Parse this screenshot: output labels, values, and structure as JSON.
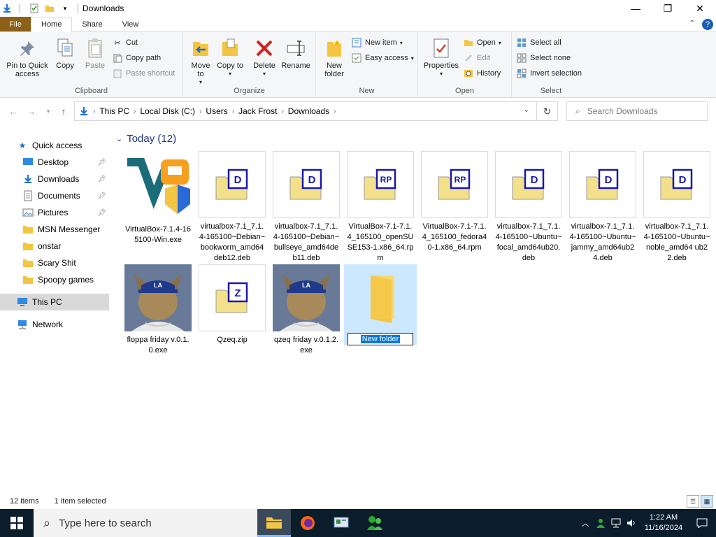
{
  "window": {
    "title": "Downloads",
    "controls": {
      "minimize": "—",
      "maximize": "❐",
      "close": "✕"
    }
  },
  "ribbon_tabs": [
    "File",
    "Home",
    "Share",
    "View"
  ],
  "ribbon": {
    "clipboard": {
      "label": "Clipboard",
      "pin": "Pin to Quick access",
      "copy": "Copy",
      "paste": "Paste",
      "cut": "Cut",
      "copy_path": "Copy path",
      "paste_shortcut": "Paste shortcut"
    },
    "organize": {
      "label": "Organize",
      "move_to": "Move to",
      "copy_to": "Copy to",
      "delete": "Delete",
      "rename": "Rename"
    },
    "new": {
      "label": "New",
      "new_folder": "New folder",
      "new_item": "New item",
      "easy_access": "Easy access"
    },
    "open": {
      "label": "Open",
      "properties": "Properties",
      "open": "Open",
      "edit": "Edit",
      "history": "History"
    },
    "select": {
      "label": "Select",
      "select_all": "Select all",
      "select_none": "Select none",
      "invert": "Invert selection"
    }
  },
  "address": {
    "crumbs": [
      "This PC",
      "Local Disk (C:)",
      "Users",
      "Jack Frost",
      "Downloads"
    ],
    "search_placeholder": "Search Downloads"
  },
  "nav": {
    "quick_access": "Quick access",
    "items": [
      {
        "label": "Desktop",
        "pinned": true
      },
      {
        "label": "Downloads",
        "pinned": true
      },
      {
        "label": "Documents",
        "pinned": true
      },
      {
        "label": "Pictures",
        "pinned": true
      },
      {
        "label": "MSN Messenger"
      },
      {
        "label": "onstar"
      },
      {
        "label": "Scary Shit"
      },
      {
        "label": "Spoopy games"
      }
    ],
    "this_pc": "This PC",
    "network": "Network"
  },
  "content": {
    "group_header": "Today (12)",
    "files": [
      {
        "name": "VirtualBox-7.1.4-165100-Win.exe"
      },
      {
        "name": "virtualbox-7.1_7.1.4-165100~Debian~bookworm_amd64deb12.deb"
      },
      {
        "name": "virtualbox-7.1_7.1.4-165100~Debian~bullseye_amd64deb11.deb"
      },
      {
        "name": "VirtualBox-7.1-7.1.4_165100_openSUSE153-1.x86_64.rpm"
      },
      {
        "name": "VirtualBox-7.1-7.1.4_165100_fedora40-1.x86_64.rpm"
      },
      {
        "name": "virtualbox-7.1_7.1.4-165100~Ubuntu~focal_amd64ub20.deb"
      },
      {
        "name": "virtualbox-7.1_7.1.4-165100~Ubuntu~jammy_amd64ub24.deb"
      },
      {
        "name": "virtualbox-7.1_7.1.4-165100~Ubuntu~noble_amd64 ub22.deb"
      },
      {
        "name": "floppa friday v.0.1.0.exe"
      },
      {
        "name": "Qzeq.zip"
      },
      {
        "name": "qzeq friday v.0.1.2.exe"
      },
      {
        "name": "New folder"
      }
    ]
  },
  "status": {
    "items": "12 items",
    "selected": "1 item selected"
  },
  "taskbar": {
    "search_placeholder": "Type here to search",
    "time": "1:22 AM",
    "date": "11/16/2024"
  }
}
